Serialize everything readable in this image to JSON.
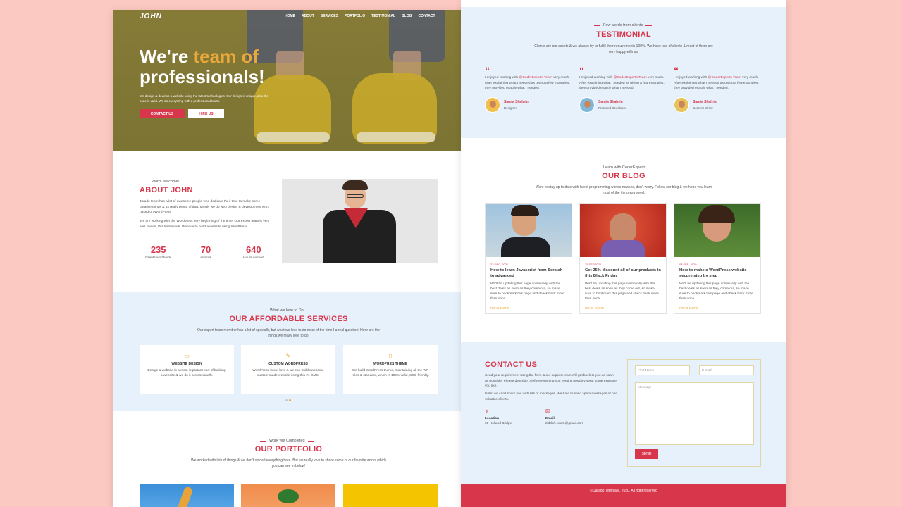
{
  "hero": {
    "logo": "JOHN",
    "nav": [
      "HOME",
      "ABOUT",
      "SERVICES",
      "PORTFOLIO",
      "TESTIMONIAL",
      "BLOG",
      "CONTACT"
    ],
    "title_line1_a": "We're ",
    "title_line1_b": "team of",
    "title_line2": "professionals!",
    "description": "We design & develop a website using the latest technologies. Our design is unique, also the code is valid. We do everything with a professional touch.",
    "btn_contact": "CONTACT US",
    "btn_hire": "HIRE US"
  },
  "about": {
    "eyebrow": "Warm welcome!",
    "title": "ABOUT JOHN",
    "p1": "Jurado team has a lot of awesome people who dedicate their time to make some creative things & us really proud of that. Mostly we do web design & development work based on WordPress",
    "p2": "We are working with the Wordpress very beginning of the time. Our expert team is very well known, this framework. We love to build a website using WordPress.",
    "stats": [
      {
        "num": "235",
        "label": "Clients worldwide"
      },
      {
        "num": "70",
        "label": "Awards"
      },
      {
        "num": "640",
        "label": "Hours worked"
      }
    ]
  },
  "services": {
    "eyebrow": "What we love to Do!",
    "title": "OUR AFFORDABLE SERVICES",
    "sub": "Our expert team member has a lot of specially, but what we love to do most of the time I a real question! Here are the things we really love to do!",
    "cards": [
      {
        "icon": "monitor-icon",
        "title": "WEBSITE DESIGN",
        "text": "Design a website is a most important part of building a website & we do it professionally."
      },
      {
        "icon": "pencil-icon",
        "title": "CUSTOM WORDPRESS",
        "text": "WordPress is our love & we can build awesome custom made website using this #1 CMS."
      },
      {
        "icon": "mobile-icon",
        "title": "WORDPRES THEME",
        "text": "We build WordPress theme, maintaining all the WP rules & standard, which is 100% valid, SEO friendly."
      }
    ]
  },
  "portfolio": {
    "eyebrow": "Work We Completed",
    "title": "OUR PORTFOLIO",
    "sub": "We worked with lots of things & we don't upload everything here. But we really love to share some of our favorite works which you can see in below!"
  },
  "testimonial": {
    "eyebrow": "Few words from clients",
    "title": "TESTIMONIAL",
    "sub": "Clients are our assets & we always try to fulfill their requirements 100%. We have lots of clients & most of them are very happy with us!",
    "cards": [
      {
        "text_a": "I enjoyed working with ",
        "highlight": "@CoderExperts Team",
        "text_b": " very much. After explaining what I needed as giving a few examples, they provided exactly what I needed.",
        "name": "Samia Shahrin",
        "role": "Designer"
      },
      {
        "text_a": "I enjoyed working with ",
        "highlight": "@CoderExperts Team",
        "text_b": " very much. After explaining what I needed as giving a few examples, they provided exactly what I needed.",
        "name": "Samia Shahrin",
        "role": "Frontend Developer"
      },
      {
        "text_a": "I enjoyed working with ",
        "highlight": "@CoderExperts Team",
        "text_b": " very much. After explaining what I needed as giving a few examples, they provided exactly what I needed.",
        "name": "Samia Shahrin",
        "role": "Content Writer"
      }
    ]
  },
  "blog": {
    "eyebrow": "Learn with CoderExperts",
    "title": "OUR BLOG",
    "sub": "Want to stay up to date with latest programming worlds newses, don't worry. Follow our blog & we hope you learn most of the thing you need.",
    "posts": [
      {
        "date": "23 DEC, 2020",
        "title": "How to learn Javascript from Scratch to advanced",
        "text": "We'll be updating this page continually with the best deals as soon as they come out, so make sure to bookmark this page and check back more than once.",
        "more": "READ MORE"
      },
      {
        "date": "25 SEP,2020",
        "title": "Get 25% discount all of our products in this Black Friday",
        "text": "We'll be updating this page continually with the best deals as soon as they come out, so make sure to bookmark this page and check back more than once.",
        "more": "READ MORE"
      },
      {
        "date": "08 FEB, 2020",
        "title": "How to make a WordPress website secure step by step",
        "text": "We'll be updating this page continually with the best deals as soon as they come out, so make sure to bookmark this page and check back more than once.",
        "more": "READ MORE"
      }
    ]
  },
  "contact": {
    "title": "CONTACT US",
    "p1": "Send your requirement using the form & our support team will get back to you as soon as possible. Please describe briefly everything you need & possibly send some example you like.",
    "p2": "Note: we can't spam you with lots of messages. We hate to send spam messages of our valuable clients.",
    "location_label": "Location",
    "location_value": "60 Holland Bridge",
    "email_label": "Email",
    "email_value": "ziddah.edem@gmail.com",
    "ph_first": "First Name",
    "ph_email": "E-mail",
    "ph_message": "Message",
    "send": "SEND"
  },
  "footer": {
    "text": "© Jurado Template. 2020. All right reserved"
  },
  "colors": {
    "accent": "#d8364a",
    "gold": "#e8a83c",
    "light_blue": "#e7f1fb",
    "backdrop": "#fbc9c1"
  }
}
